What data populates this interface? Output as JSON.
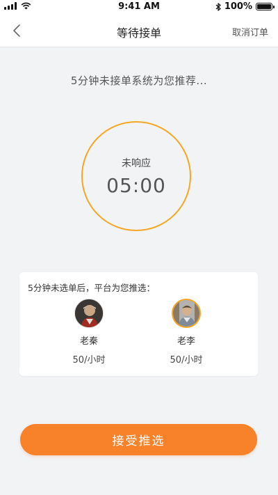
{
  "status_bar": {
    "time": "9:41 AM",
    "battery": "100%",
    "battery_level": 1.0,
    "icons": [
      "signal-icon",
      "wifi-icon",
      "bluetooth-icon",
      "battery-icon"
    ]
  },
  "nav": {
    "title": "等待接单",
    "cancel_label": "取消订单",
    "back_icon": "chevron-left-icon"
  },
  "hint": "5分钟未接单系统为您推荐...",
  "timer": {
    "status": "未响应",
    "value": "05:00"
  },
  "recommend": {
    "title": "5分钟未选单后，平台为您推选：",
    "drivers": [
      {
        "name": "老秦",
        "rate": "50/小时"
      },
      {
        "name": "老李",
        "rate": "50/小时"
      }
    ]
  },
  "accept_label": "接受推选",
  "colors": {
    "accent": "#f7822a",
    "ring": "#f5a623",
    "background": "#f2f3f5"
  }
}
